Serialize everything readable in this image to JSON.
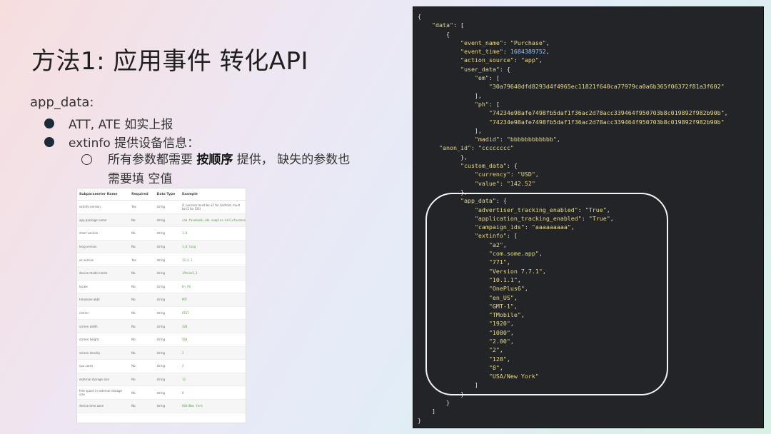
{
  "slide": {
    "title": "方法1: 应用事件 转化API",
    "app_data_label": "app_data:",
    "bullets": [
      "ATT, ATE 如实上报",
      "extinfo 提供设备信息："
    ],
    "sub_bullet": {
      "prefix": "所有参数都需要 ",
      "bold": "按顺序",
      "suffix": " 提供， 缺失的参数也需要填 空值"
    }
  },
  "param_table": {
    "headers": [
      "Subparameter Name",
      "Required",
      "Data Type",
      "Example"
    ],
    "rows": [
      [
        "extinfo version",
        "Yes",
        "string",
        "i2 (version must be a2 for Android, must be i2 for iOS)"
      ],
      [
        "app package name",
        "No",
        "string",
        "com.facebook.sdk.samples.hellofacebook"
      ],
      [
        "short version",
        "No",
        "string",
        "1.0"
      ],
      [
        "long version",
        "No",
        "string",
        "1.0 long"
      ],
      [
        "os version",
        "Yes",
        "string",
        "13.4.1"
      ],
      [
        "device model name",
        "No",
        "string",
        "iPhone5,1"
      ],
      [
        "locale",
        "No",
        "string",
        "En_US"
      ],
      [
        "timezone abbr",
        "No",
        "string",
        "PDT"
      ],
      [
        "carrier",
        "No",
        "string",
        "AT&T"
      ],
      [
        "screen width",
        "No",
        "string",
        "320"
      ],
      [
        "screen height",
        "No",
        "string",
        "568"
      ],
      [
        "screen density",
        "No",
        "string",
        "2"
      ],
      [
        "cpu cores",
        "No",
        "string",
        "2"
      ],
      [
        "external storage size",
        "No",
        "string",
        "13"
      ],
      [
        "free space in external storage size",
        "No",
        "string",
        "8"
      ],
      [
        "device time zone",
        "No",
        "string",
        "USA/New York"
      ]
    ]
  },
  "code": {
    "lines": [
      "{",
      "    \"data\": [",
      "        {",
      "            \"event_name\": \"Purchase\",",
      "            \"event_time\": 1684389752,",
      "            \"action_source\": \"app\",",
      "            \"user_data\": {",
      "                \"em\": [",
      "                    \"30a79640dfd8293d4f4965ec11821f640ca77979ca0a6b365f06372f81a3f602\"",
      "                ],",
      "                \"ph\": [",
      "                    \"74234e98afe7498fb5daf1f36ac2d78acc339464f950703b8c019892f982b90b\",",
      "                    \"74234e98afe7498fb5daf1f36ac2d78acc339464f950703b8c019892f982b90b\"",
      "                ],",
      "                \"madid\": \"bbbbbbbbbbbb\",",
      "      \"anon_id\": \"cccccccc\"",
      "            },",
      "            \"custom_data\": {",
      "                \"currency\": \"USD\",",
      "                \"value\": \"142.52\"",
      "            },",
      "            \"app_data\": {",
      "                \"advertiser_tracking_enabled\": \"True\",",
      "                \"application_tracking_enabled\": \"True\",",
      "                \"campaign_ids\": \"aaaaaaaaa\",",
      "                \"extinfo\": [",
      "                    \"a2\",",
      "                    \"com.some.app\",",
      "                    \"771\",",
      "                    \"Version 7.7.1\",",
      "                    \"10.1.1\",",
      "                    \"OnePlus6\",",
      "                    \"en_US\",",
      "                    \"GMT-1\",",
      "                    \"TMobile\",",
      "                    \"1920\",",
      "                    \"1080\",",
      "                    \"2.00\",",
      "                    \"2\",",
      "                    \"128\",",
      "                    \"8\",",
      "                    \"USA/New York\"",
      "                ]",
      "            }",
      "        }",
      "    ]",
      "}"
    ]
  },
  "colors": {
    "code_bg": "#222427",
    "string": "#e8d98a",
    "number": "#8fc7ff",
    "table_example": "#4fa53a"
  }
}
